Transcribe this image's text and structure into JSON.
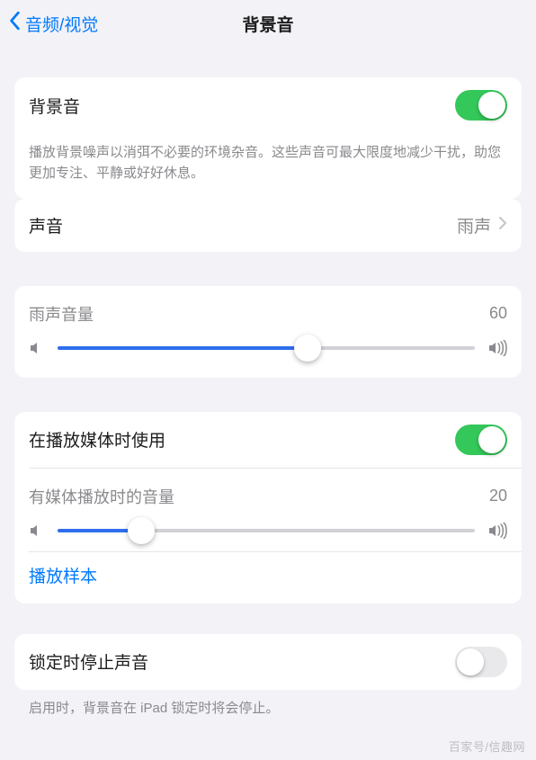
{
  "nav": {
    "back_label": "音频/视觉",
    "title": "背景音"
  },
  "group1": {
    "toggle_label": "背景音",
    "toggle_on": true,
    "description": "播放背景噪声以消弭不必要的环境杂音。这些声音可最大限度地减少干扰，助您更加专注、平静或好好休息。"
  },
  "group2": {
    "sound_label": "声音",
    "sound_value": "雨声"
  },
  "group3": {
    "volume_label": "雨声音量",
    "volume_value": "60",
    "volume_percent": 60
  },
  "group4": {
    "media_toggle_label": "在播放媒体时使用",
    "media_toggle_on": true,
    "media_volume_label": "有媒体播放时的音量",
    "media_volume_value": "20",
    "media_volume_percent": 20,
    "sample_label": "播放样本"
  },
  "group5": {
    "lock_toggle_label": "锁定时停止声音",
    "lock_toggle_on": false,
    "lock_description": "启用时，背景音在 iPad 锁定时将会停止。"
  },
  "watermark": "百家号/信趣网"
}
